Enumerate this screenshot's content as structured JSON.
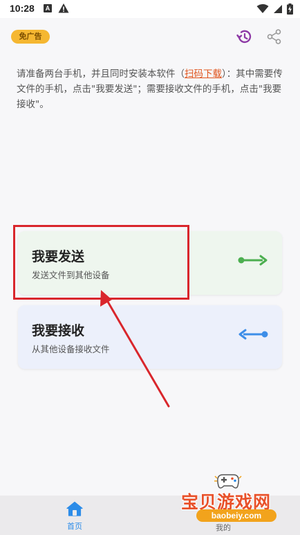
{
  "status_bar": {
    "time": "10:28",
    "icons": [
      "a-icon",
      "warning-icon",
      "wifi-icon",
      "signal-icon",
      "battery-icon"
    ]
  },
  "top_bar": {
    "ad_badge": "免广告",
    "icons": [
      "history-icon",
      "share-icon"
    ]
  },
  "intro": {
    "text_before_link": "请准备两台手机，并且同时安装本软件（",
    "link": "扫码下载",
    "text_after_link": "）：其中需要传文件的手机，点击\"我要发送\"；需要接收文件的手机，点击\"我要接收\"。"
  },
  "cards": {
    "send": {
      "title": "我要发送",
      "subtitle": "发送文件到其他设备",
      "icon": "send-arrow-icon"
    },
    "receive": {
      "title": "我要接收",
      "subtitle": "从其他设备接收文件",
      "icon": "receive-arrow-icon"
    }
  },
  "bottom_nav": {
    "home_label": "首页",
    "mine_label": "我的"
  },
  "watermark": {
    "title": "宝贝游戏网",
    "url": "baobeiy.com"
  },
  "colors": {
    "accent": "#2c8ce8",
    "send_green": "#4caf50",
    "receive_blue": "#3d8ee8",
    "annotation_red": "#d9262c",
    "ad_badge": "#f5b731",
    "link": "#e0541c",
    "history_purple": "#8e3aa6"
  }
}
